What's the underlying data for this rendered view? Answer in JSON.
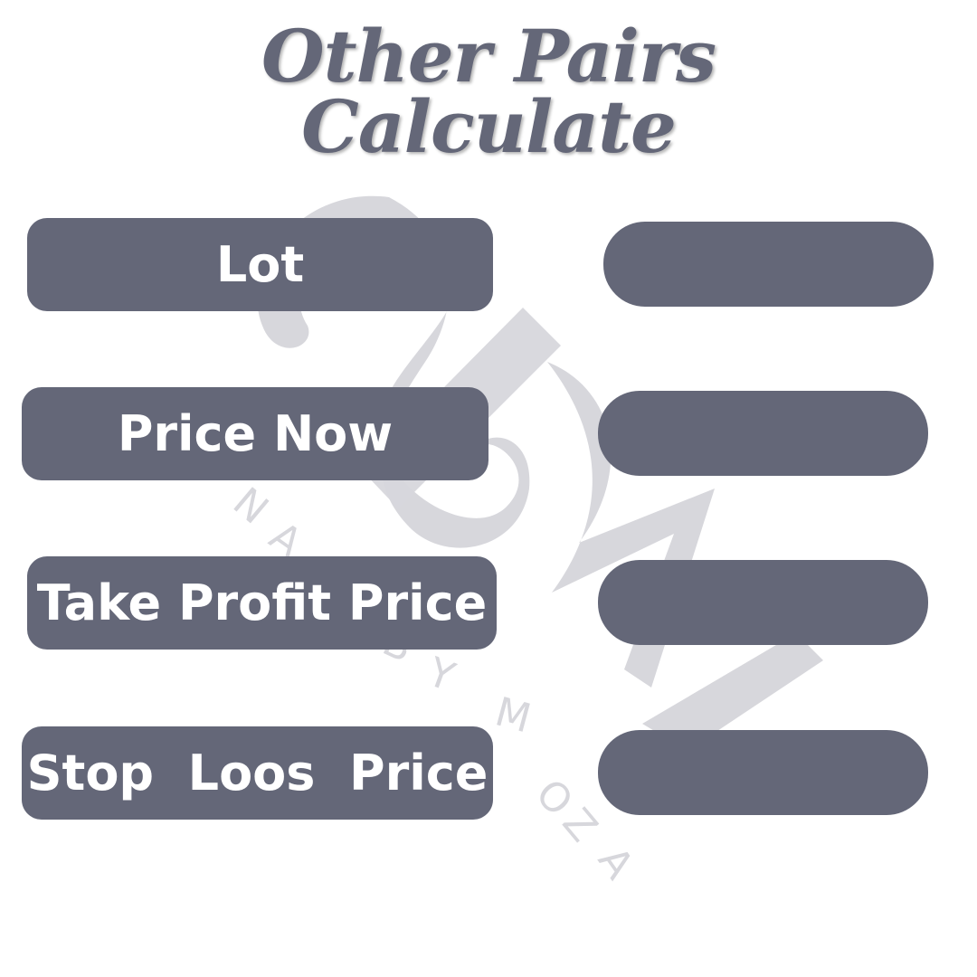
{
  "title": {
    "line1": "Other Pairs",
    "line2": "Calculate"
  },
  "fields": [
    {
      "label": "Lot",
      "value": ""
    },
    {
      "label": "Price Now",
      "value": ""
    },
    {
      "label": "Take Profit Price",
      "value": ""
    },
    {
      "label": "Stop  Loos  Price",
      "value": ""
    }
  ],
  "watermark": {
    "text": "NAILS BY MOZA",
    "monogram": "SM"
  },
  "colors": {
    "accent": "#646778",
    "watermark": "#d7d7dc",
    "background": "#ffffff"
  }
}
